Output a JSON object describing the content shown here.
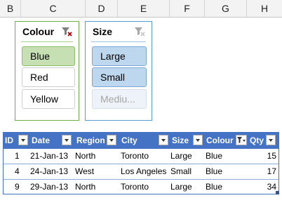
{
  "columns": [
    "B",
    "C",
    "D",
    "E",
    "F",
    "G",
    "H"
  ],
  "slicers": {
    "colour": {
      "title": "Colour",
      "items": [
        {
          "label": "Blue",
          "state": "selected"
        },
        {
          "label": "Red",
          "state": "normal"
        },
        {
          "label": "Yellow",
          "state": "normal"
        }
      ],
      "accent": "#70ad47"
    },
    "size": {
      "title": "Size",
      "items": [
        {
          "label": "Large",
          "state": "selected"
        },
        {
          "label": "Small",
          "state": "selected"
        },
        {
          "label": "Mediu...",
          "state": "no-data"
        }
      ],
      "accent": "#5b9bd5"
    }
  },
  "table": {
    "headers": [
      "ID",
      "Date",
      "Region",
      "City",
      "Size",
      "Colour",
      "Qty"
    ],
    "rows": [
      [
        "1",
        "21-Jan-13",
        "North",
        "Toronto",
        "Large",
        "Blue",
        "15"
      ],
      [
        "4",
        "24-Jan-13",
        "West",
        "Los Angeles",
        "Small",
        "Blue",
        "17"
      ],
      [
        "9",
        "29-Jan-13",
        "North",
        "Toronto",
        "Large",
        "Blue",
        "34"
      ]
    ],
    "header_color": "#4472c4",
    "filtered_column": "Colour"
  }
}
